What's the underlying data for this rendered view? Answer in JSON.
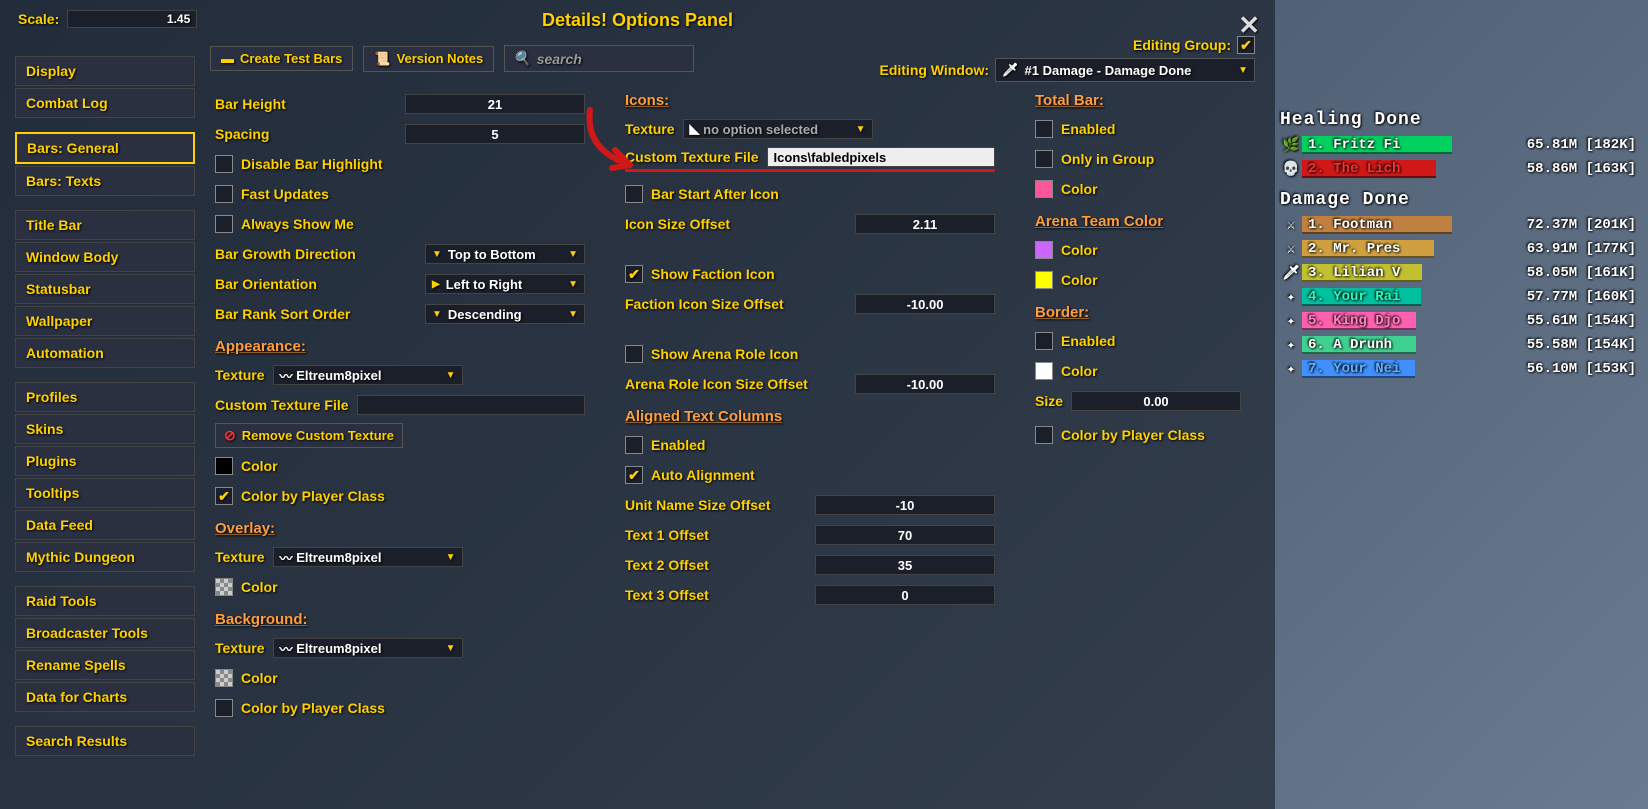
{
  "title": "Details! Options Panel",
  "scale": {
    "label": "Scale:",
    "value": "1.45"
  },
  "topbar": {
    "create_test_bars": "Create Test Bars",
    "version_notes": "Version Notes",
    "search_placeholder": "search"
  },
  "editing": {
    "group_label": "Editing Group:",
    "group_checked": true,
    "window_label": "Editing Window:",
    "window_value": "#1 Damage - Damage Done"
  },
  "sidebar": {
    "groups": [
      {
        "items": [
          {
            "label": "Display"
          },
          {
            "label": "Combat Log"
          }
        ]
      },
      {
        "items": [
          {
            "label": "Bars: General",
            "active": true
          },
          {
            "label": "Bars: Texts"
          }
        ]
      },
      {
        "items": [
          {
            "label": "Title Bar"
          },
          {
            "label": "Window Body"
          },
          {
            "label": "Statusbar"
          },
          {
            "label": "Wallpaper"
          },
          {
            "label": "Automation"
          }
        ]
      },
      {
        "items": [
          {
            "label": "Profiles"
          },
          {
            "label": "Skins"
          },
          {
            "label": "Plugins"
          },
          {
            "label": "Tooltips"
          },
          {
            "label": "Data Feed"
          },
          {
            "label": "Mythic Dungeon"
          }
        ]
      },
      {
        "items": [
          {
            "label": "Raid Tools"
          },
          {
            "label": "Broadcaster Tools"
          },
          {
            "label": "Rename Spells"
          },
          {
            "label": "Data for Charts"
          }
        ]
      },
      {
        "items": [
          {
            "label": "Search Results"
          }
        ]
      }
    ]
  },
  "col1": {
    "bar_height": {
      "label": "Bar Height",
      "value": "21"
    },
    "spacing": {
      "label": "Spacing",
      "value": "5"
    },
    "disable_highlight": {
      "label": "Disable Bar Highlight",
      "checked": false
    },
    "fast_updates": {
      "label": "Fast Updates",
      "checked": false
    },
    "always_show_me": {
      "label": "Always Show Me",
      "checked": false
    },
    "growth": {
      "label": "Bar Growth Direction",
      "value": "Top to Bottom"
    },
    "orientation": {
      "label": "Bar Orientation",
      "value": "Left to Right"
    },
    "sort_order": {
      "label": "Bar Rank Sort Order",
      "value": "Descending"
    },
    "appearance_head": "Appearance:",
    "appearance": {
      "texture_label": "Texture",
      "texture_value": "Eltreum8pixel",
      "custom_file_label": "Custom Texture File",
      "remove_custom": "Remove Custom Texture",
      "color_label": "Color",
      "color_by_class": {
        "label": "Color by Player Class",
        "checked": true
      }
    },
    "overlay_head": "Overlay:",
    "overlay": {
      "texture_label": "Texture",
      "texture_value": "Eltreum8pixel",
      "color_label": "Color"
    },
    "background_head": "Background:",
    "background": {
      "texture_label": "Texture",
      "texture_value": "Eltreum8pixel",
      "color_label": "Color",
      "color_by_class": {
        "label": "Color by Player Class",
        "checked": false
      }
    }
  },
  "col2": {
    "icons_head": "Icons:",
    "texture_label": "Texture",
    "texture_value": "no option selected",
    "custom_file_label": "Custom Texture File",
    "custom_file_value": "Icons\\fabledpixels",
    "bar_start_after": {
      "label": "Bar Start After Icon",
      "checked": false
    },
    "icon_size_offset": {
      "label": "Icon Size Offset",
      "value": "2.11"
    },
    "show_faction": {
      "label": "Show Faction Icon",
      "checked": true
    },
    "faction_offset": {
      "label": "Faction Icon Size Offset",
      "value": "-10.00"
    },
    "show_arena": {
      "label": "Show Arena Role Icon",
      "checked": false
    },
    "arena_offset": {
      "label": "Arena Role Icon Size Offset",
      "value": "-10.00"
    },
    "atc_head": "Aligned Text Columns",
    "atc_enabled": {
      "label": "Enabled",
      "checked": false
    },
    "atc_auto": {
      "label": "Auto Alignment",
      "checked": true
    },
    "unit_name_offset": {
      "label": "Unit Name Size Offset",
      "value": "-10"
    },
    "t1": {
      "label": "Text 1 Offset",
      "value": "70"
    },
    "t2": {
      "label": "Text 2 Offset",
      "value": "35"
    },
    "t3": {
      "label": "Text 3 Offset",
      "value": "0"
    }
  },
  "col3": {
    "total_bar_head": "Total Bar:",
    "tb_enabled": {
      "label": "Enabled",
      "checked": false
    },
    "tb_group": {
      "label": "Only in Group",
      "checked": false
    },
    "tb_color": "Color",
    "arena_head": "Arena Team Color",
    "arena_color1": "Color",
    "arena_color2": "Color",
    "border_head": "Border:",
    "b_enabled": {
      "label": "Enabled",
      "checked": false
    },
    "b_color": "Color",
    "b_size": {
      "label": "Size",
      "value": "0.00"
    },
    "b_color_class": {
      "label": "Color by Player Class",
      "checked": false
    }
  },
  "meters": {
    "healing_head": "Healing Done",
    "healing": [
      {
        "rank": "1.",
        "name": "Fritz Fi",
        "left": "1. Fritz Fi",
        "right": "65.81M [182K]",
        "color": "#00d060",
        "fill": 100,
        "icon": "🌿"
      },
      {
        "rank": "2.",
        "name": "The Lich",
        "left": "2. The Lich",
        "right": "58.86M [163K]",
        "color": "#d01818",
        "fill": 89,
        "icon": "💀",
        "red": true
      }
    ],
    "damage_head": "Damage Done",
    "damage": [
      {
        "left": "1. Footman",
        "right": "72.37M [201K]",
        "color": "#c08040",
        "fill": 100,
        "icon": "⚔"
      },
      {
        "left": "2. Mr. Pres",
        "right": "63.91M [177K]",
        "color": "#d0a040",
        "fill": 88,
        "icon": "⚔"
      },
      {
        "left": "3. Lilian V",
        "right": "58.05M [161K]",
        "color": "#c0c030",
        "fill": 80,
        "icon": "🗡"
      },
      {
        "left": "4. Your Rai",
        "right": "57.77M [160K]",
        "color": "#00c0a0",
        "fill": 79,
        "icon": "✦",
        "textcolor": "#20ffc0"
      },
      {
        "left": "5. King Djo",
        "right": "55.61M [154K]",
        "color": "#ff60b0",
        "fill": 76,
        "icon": "✦",
        "textcolor": "#ff80c0"
      },
      {
        "left": "6. A Drunh",
        "right": "55.58M [154K]",
        "color": "#40d090",
        "fill": 76,
        "icon": "✦"
      },
      {
        "left": "7. Your Nei",
        "right": "56.10M [153K]",
        "color": "#4090ff",
        "fill": 75,
        "icon": "✦",
        "textcolor": "#60b0ff"
      }
    ]
  }
}
